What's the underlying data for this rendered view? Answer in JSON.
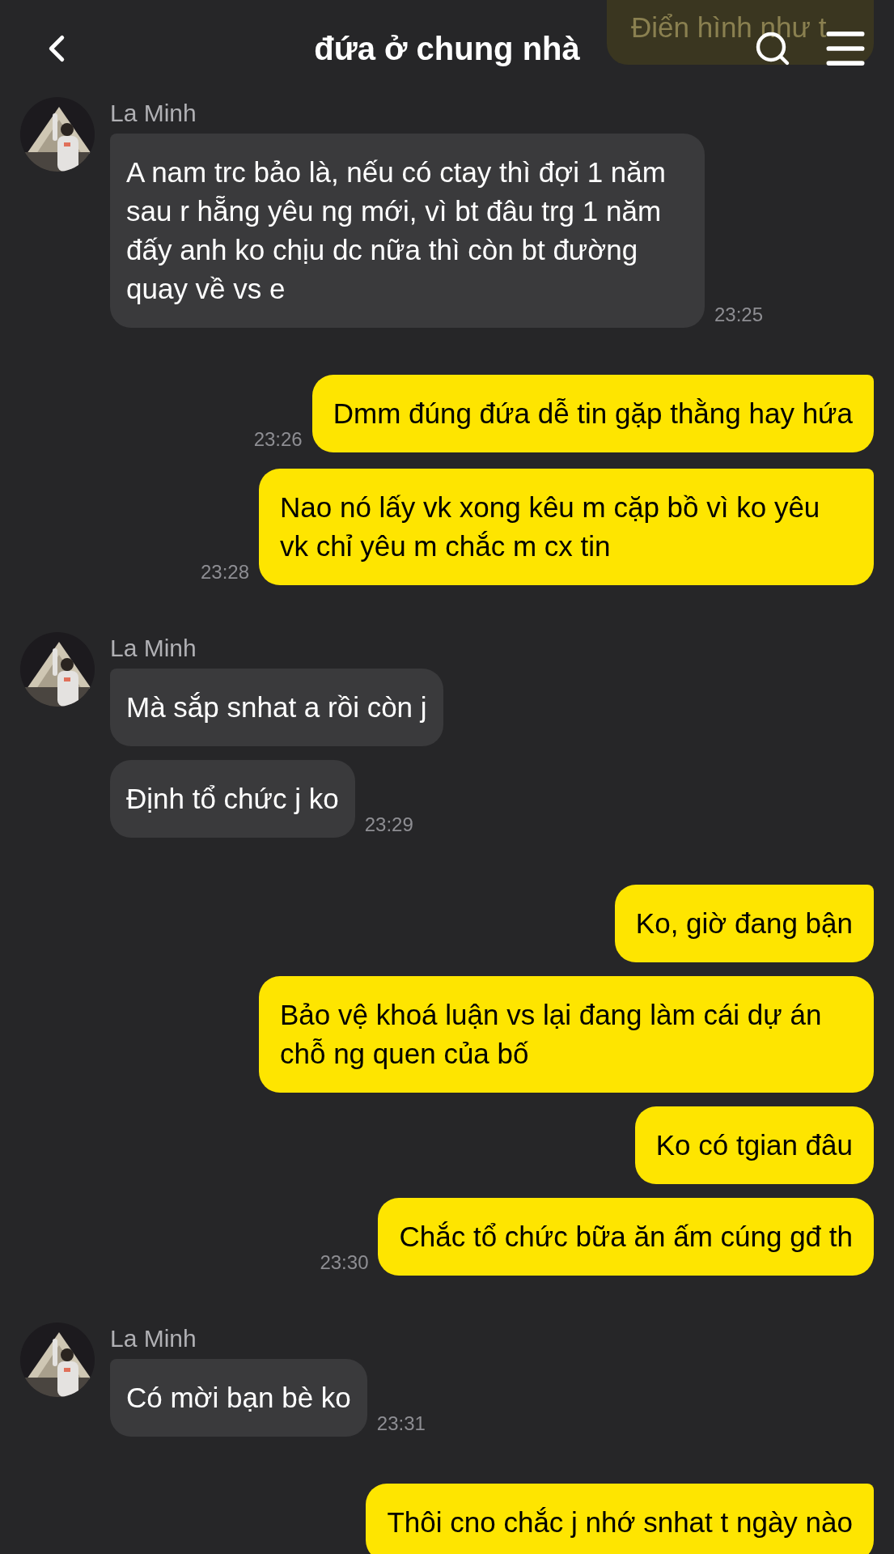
{
  "header": {
    "title": "đứa ở chung nhà",
    "peeked_message": "Điển hình như t"
  },
  "groups": [
    {
      "kind": "incoming",
      "sender": "La Minh",
      "avatar": {
        "kind": "picture"
      },
      "bubbles": [
        "A nam trc bảo là, nếu có ctay thì đợi 1 năm sau r hẵng yêu ng mới, vì bt đâu trg 1 năm đấy anh ko chịu dc nữa thì còn bt đường quay về vs e"
      ],
      "time": "23:25"
    },
    {
      "kind": "outgoing",
      "bubbles": [
        "Dmm đúng đứa dễ tin gặp thằng hay hứa"
      ],
      "time": "23:26"
    },
    {
      "kind": "outgoing",
      "bubbles": [
        "Nao nó lấy vk xong kêu m cặp bồ vì ko yêu vk chỉ yêu m chắc m cx tin"
      ],
      "time": "23:28"
    },
    {
      "kind": "incoming",
      "sender": "La Minh",
      "avatar": {
        "kind": "picture"
      },
      "bubbles": [
        "Mà sắp snhat a rồi còn j",
        "Định tổ chức j ko"
      ],
      "time": "23:29"
    },
    {
      "kind": "outgoing",
      "bubbles": [
        "Ko, giờ đang bận",
        "Bảo vệ khoá luận vs lại đang làm cái dự án chỗ ng quen của bố",
        "Ko có tgian đâu",
        "Chắc tổ chức bữa ăn ấm cúng gđ th"
      ],
      "time": "23:30"
    },
    {
      "kind": "incoming",
      "sender": "La Minh",
      "avatar": {
        "kind": "picture"
      },
      "bubbles": [
        "Có mời bạn bè ko"
      ],
      "time": "23:31"
    },
    {
      "kind": "outgoing",
      "bubbles": [
        "Thôi cno chắc j nhớ snhat t ngày nào"
      ]
    }
  ]
}
